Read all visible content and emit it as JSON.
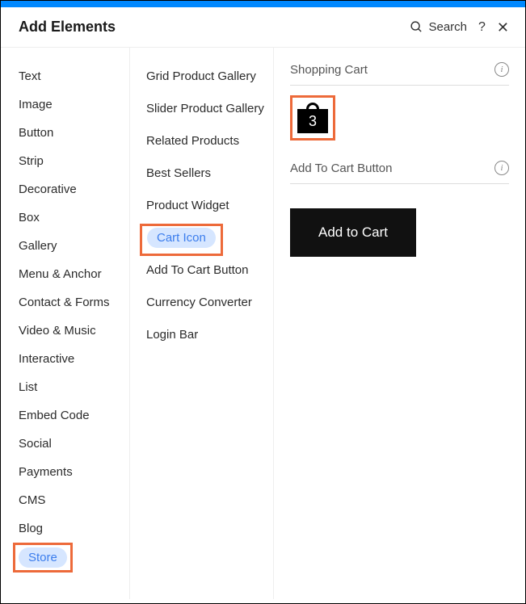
{
  "header": {
    "title": "Add Elements",
    "search_label": "Search"
  },
  "categories": [
    {
      "label": "Text",
      "selected": false
    },
    {
      "label": "Image",
      "selected": false
    },
    {
      "label": "Button",
      "selected": false
    },
    {
      "label": "Strip",
      "selected": false
    },
    {
      "label": "Decorative",
      "selected": false
    },
    {
      "label": "Box",
      "selected": false
    },
    {
      "label": "Gallery",
      "selected": false
    },
    {
      "label": "Menu & Anchor",
      "selected": false
    },
    {
      "label": "Contact & Forms",
      "selected": false
    },
    {
      "label": "Video & Music",
      "selected": false
    },
    {
      "label": "Interactive",
      "selected": false
    },
    {
      "label": "List",
      "selected": false
    },
    {
      "label": "Embed Code",
      "selected": false
    },
    {
      "label": "Social",
      "selected": false
    },
    {
      "label": "Payments",
      "selected": false
    },
    {
      "label": "CMS",
      "selected": false
    },
    {
      "label": "Blog",
      "selected": false
    },
    {
      "label": "Store",
      "selected": true
    }
  ],
  "subcategories": [
    {
      "label": "Grid Product Gallery",
      "selected": false
    },
    {
      "label": "Slider Product Gallery",
      "selected": false
    },
    {
      "label": "Related Products",
      "selected": false
    },
    {
      "label": "Best Sellers",
      "selected": false
    },
    {
      "label": "Product Widget",
      "selected": false
    },
    {
      "label": "Cart Icon",
      "selected": true
    },
    {
      "label": "Add To Cart Button",
      "selected": false
    },
    {
      "label": "Currency Converter",
      "selected": false
    },
    {
      "label": "Login Bar",
      "selected": false
    }
  ],
  "preview": {
    "shopping_cart_label": "Shopping Cart",
    "cart_count": "3",
    "add_to_cart_section_label": "Add To Cart Button",
    "add_to_cart_button_label": "Add to Cart"
  }
}
